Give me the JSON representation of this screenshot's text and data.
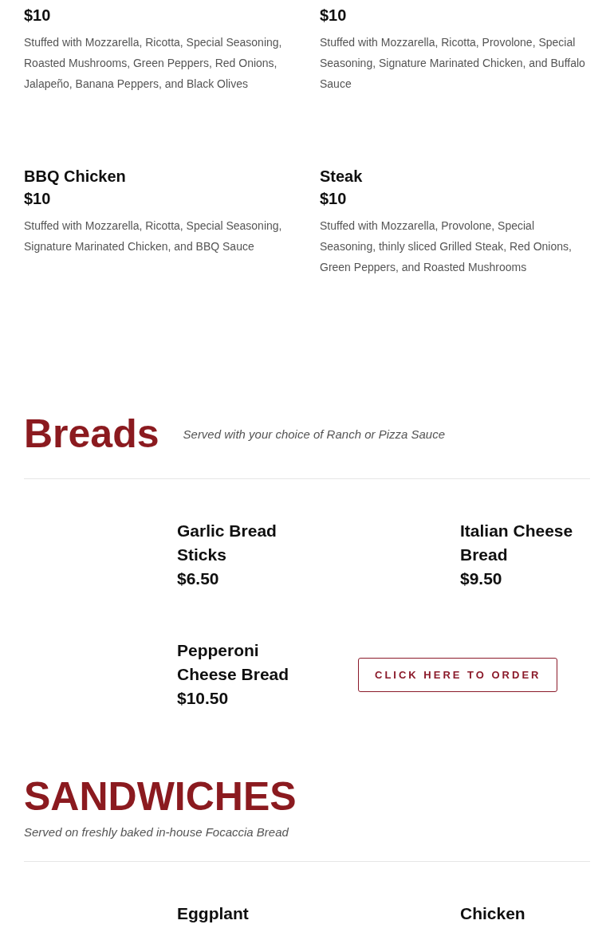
{
  "pizza_items": [
    {
      "price": "$10",
      "description": "Stuffed with Mozzarella, Ricotta, Special Seasoning, Roasted Mushrooms, Green Peppers, Red Onions, Jalapeño, Banana Peppers, and Black Olives"
    },
    {
      "price": "$10",
      "description": "Stuffed with Mozzarella, Ricotta, Provolone, Special Seasoning, Signature Marinated Chicken, and Buffalo Sauce"
    },
    {
      "name": "BBQ Chicken",
      "price": "$10",
      "description": "Stuffed with Mozzarella, Ricotta, Special Seasoning, Signature Marinated Chicken, and BBQ Sauce"
    },
    {
      "name": "Steak",
      "price": "$10",
      "description": "Stuffed with Mozzarella, Provolone, Special Seasoning, thinly sliced Grilled Steak, Red Onions, Green Peppers, and Roasted Mushrooms"
    }
  ],
  "breads": {
    "title": "Breads",
    "subtitle": "Served with your choice of Ranch or Pizza Sauce",
    "items": [
      {
        "name": "Garlic Bread Sticks",
        "price": "$6.50"
      },
      {
        "name": "Italian Cheese Bread",
        "price": "$9.50"
      },
      {
        "name": "Pepperoni Cheese Bread",
        "price": "$10.50"
      }
    ],
    "order_button": "CLICK HERE TO ORDER"
  },
  "sandwiches": {
    "title": "SANDWICHES",
    "subtitle": "Served on freshly baked in-house Focaccia Bread",
    "items": [
      {
        "name": "Eggplant"
      },
      {
        "name": "Chicken"
      }
    ]
  }
}
